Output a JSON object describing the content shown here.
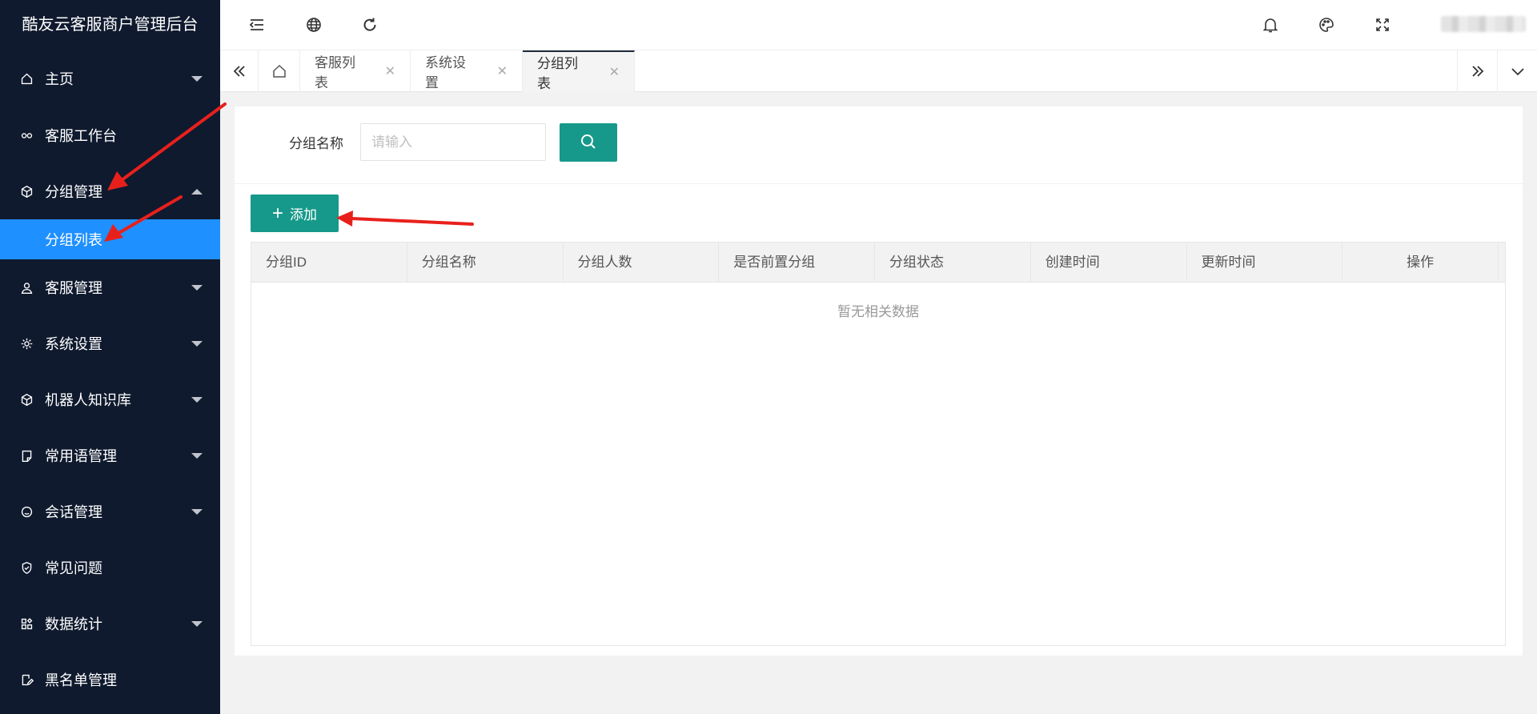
{
  "app": {
    "title": "酷友云客服商户管理后台"
  },
  "sidebar": {
    "items": [
      {
        "label": "主页",
        "icon": "home-icon"
      },
      {
        "label": "客服工作台",
        "icon": "link-icon"
      },
      {
        "label": "分组管理",
        "icon": "cube-icon",
        "expanded": true
      },
      {
        "label": "分组列表",
        "active": true
      },
      {
        "label": "客服管理",
        "icon": "user-icon"
      },
      {
        "label": "系统设置",
        "icon": "gear-icon"
      },
      {
        "label": "机器人知识库",
        "icon": "cube-icon"
      },
      {
        "label": "常用语管理",
        "icon": "note-icon"
      },
      {
        "label": "会话管理",
        "icon": "smile-icon"
      },
      {
        "label": "常见问题",
        "icon": "shield-icon"
      },
      {
        "label": "数据统计",
        "icon": "apps-icon"
      },
      {
        "label": "黑名单管理",
        "icon": "edit-icon"
      }
    ]
  },
  "tabs": [
    {
      "label": "客服列表"
    },
    {
      "label": "系统设置"
    },
    {
      "label": "分组列表",
      "active": true
    }
  ],
  "search": {
    "label": "分组名称",
    "placeholder": "请输入",
    "value": ""
  },
  "toolbar": {
    "add_label": "添加"
  },
  "table": {
    "columns": [
      "分组ID",
      "分组名称",
      "分组人数",
      "是否前置分组",
      "分组状态",
      "创建时间",
      "更新时间",
      "操作"
    ],
    "empty_text": "暂无相关数据"
  },
  "colors": {
    "sidebar_bg": "#0f1a2e",
    "active_item": "#1e90ff",
    "primary_button": "#16998a",
    "annotation_arrow": "#e8201c"
  }
}
